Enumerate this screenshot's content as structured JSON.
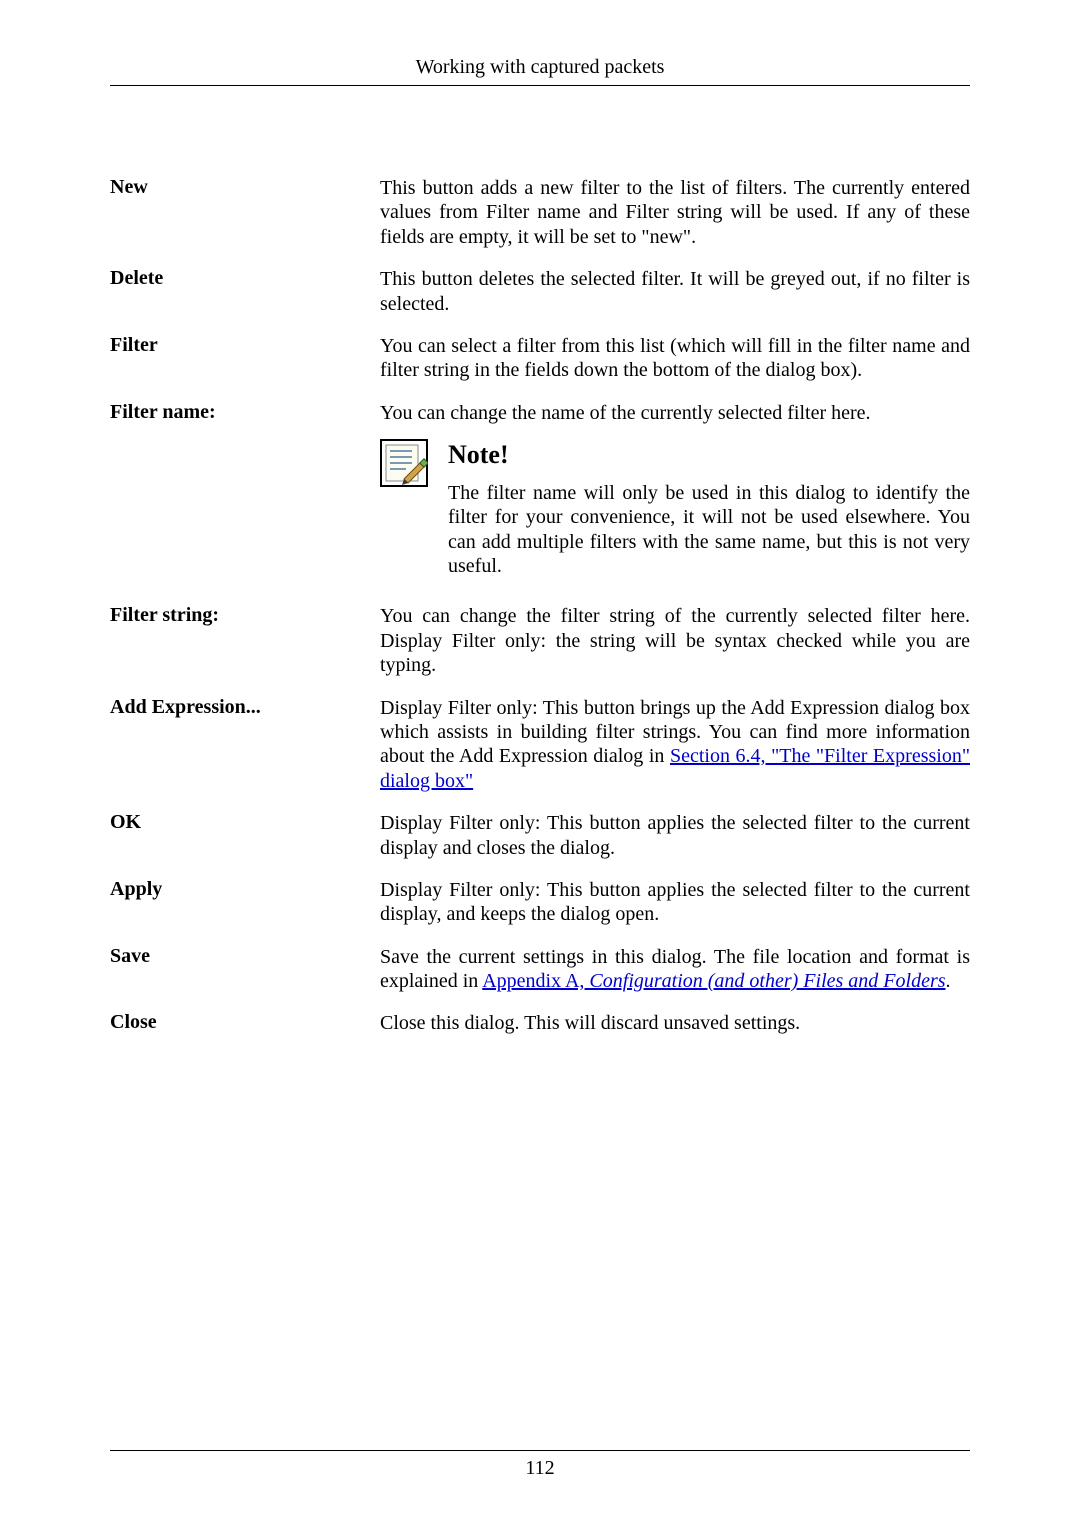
{
  "header": {
    "title": "Working with captured packets"
  },
  "entries": {
    "new": {
      "term": "New",
      "desc": "This button adds a new filter to the list of filters. The currently entered values from Filter name and Filter string will be used. If any of these fields are empty, it will be set to \"new\"."
    },
    "delete": {
      "term": "Delete",
      "desc": "This button deletes the selected filter. It will be greyed out, if no filter is selected."
    },
    "filter": {
      "term": "Filter",
      "desc": "You can select a filter from this list (which will fill in the filter name and filter string in the fields down the bottom of the dialog box)."
    },
    "filter_name": {
      "term": "Filter name:",
      "desc": "You can change the name of the currently selected filter here.",
      "note_title": "Note!",
      "note_body": "The filter name will only be used in this dialog to identify the filter for your convenience, it will not be used elsewhere. You can add multiple filters with the same name, but this is not very useful."
    },
    "filter_string": {
      "term": "Filter string:",
      "desc": "You can change the filter string of the currently selected filter here. Display Filter only: the string will be syntax checked while you are typing."
    },
    "add_expression": {
      "term": "Add Expression...",
      "desc_pre": "Display Filter only: This button brings up the Add Expression dialog box which assists in building filter strings. You can find more information about the Add Expression dialog in ",
      "link": "Section 6.4, \"The \"Filter Expression\" dialog box\""
    },
    "ok": {
      "term": "OK",
      "desc": "Display Filter only: This button applies the selected filter to the current display and closes the dialog."
    },
    "apply": {
      "term": "Apply",
      "desc": "Display Filter only: This button applies the selected filter to the current display, and keeps the dialog open."
    },
    "save": {
      "term": "Save",
      "desc_pre": "Save the current settings in this dialog. The file location and format is explained in ",
      "link_plain": "Appendix A, ",
      "link_italic": "Configuration (and other) Files and Folders",
      "desc_post": "."
    },
    "close": {
      "term": "Close",
      "desc": "Close this dialog. This will discard unsaved settings."
    }
  },
  "footer": {
    "page_number": "112"
  }
}
